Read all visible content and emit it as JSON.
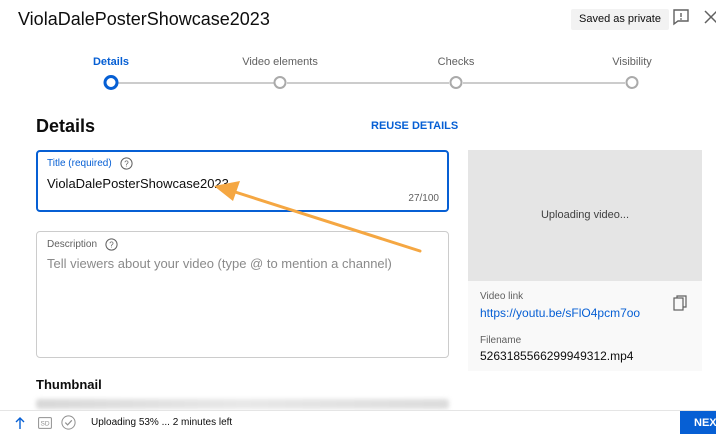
{
  "header": {
    "video_title": "ViolaDalePosterShowcase2023",
    "saved_badge": "Saved as private"
  },
  "stepper": {
    "steps": [
      {
        "label": "Details",
        "active": true
      },
      {
        "label": "Video elements",
        "active": false
      },
      {
        "label": "Checks",
        "active": false
      },
      {
        "label": "Visibility",
        "active": false
      }
    ]
  },
  "details": {
    "heading": "Details",
    "reuse_label": "REUSE DETAILS",
    "title_field": {
      "label": "Title (required)",
      "value": "ViolaDalePosterShowcase2023",
      "char_count": "27/100"
    },
    "description_field": {
      "label": "Description",
      "placeholder": "Tell viewers about your video (type @ to mention a channel)"
    },
    "thumbnail_heading": "Thumbnail"
  },
  "preview": {
    "uploading_text": "Uploading video...",
    "link_label": "Video link",
    "link_url": "https://youtu.be/sFlO4pcm7oo",
    "filename_label": "Filename",
    "filename": "5263185566299949312.mp4"
  },
  "footer": {
    "sd_label": "SD",
    "status": "Uploading 53% ... 2 minutes left",
    "next_label": "NEXT"
  },
  "colors": {
    "accent": "#065fd4",
    "annotation_arrow": "#f5a742"
  },
  "icons": [
    "feedback-icon",
    "close-icon",
    "help-icon",
    "copy-icon",
    "upload-icon",
    "sd-icon",
    "check-circle-icon",
    "arrow-annotation"
  ]
}
